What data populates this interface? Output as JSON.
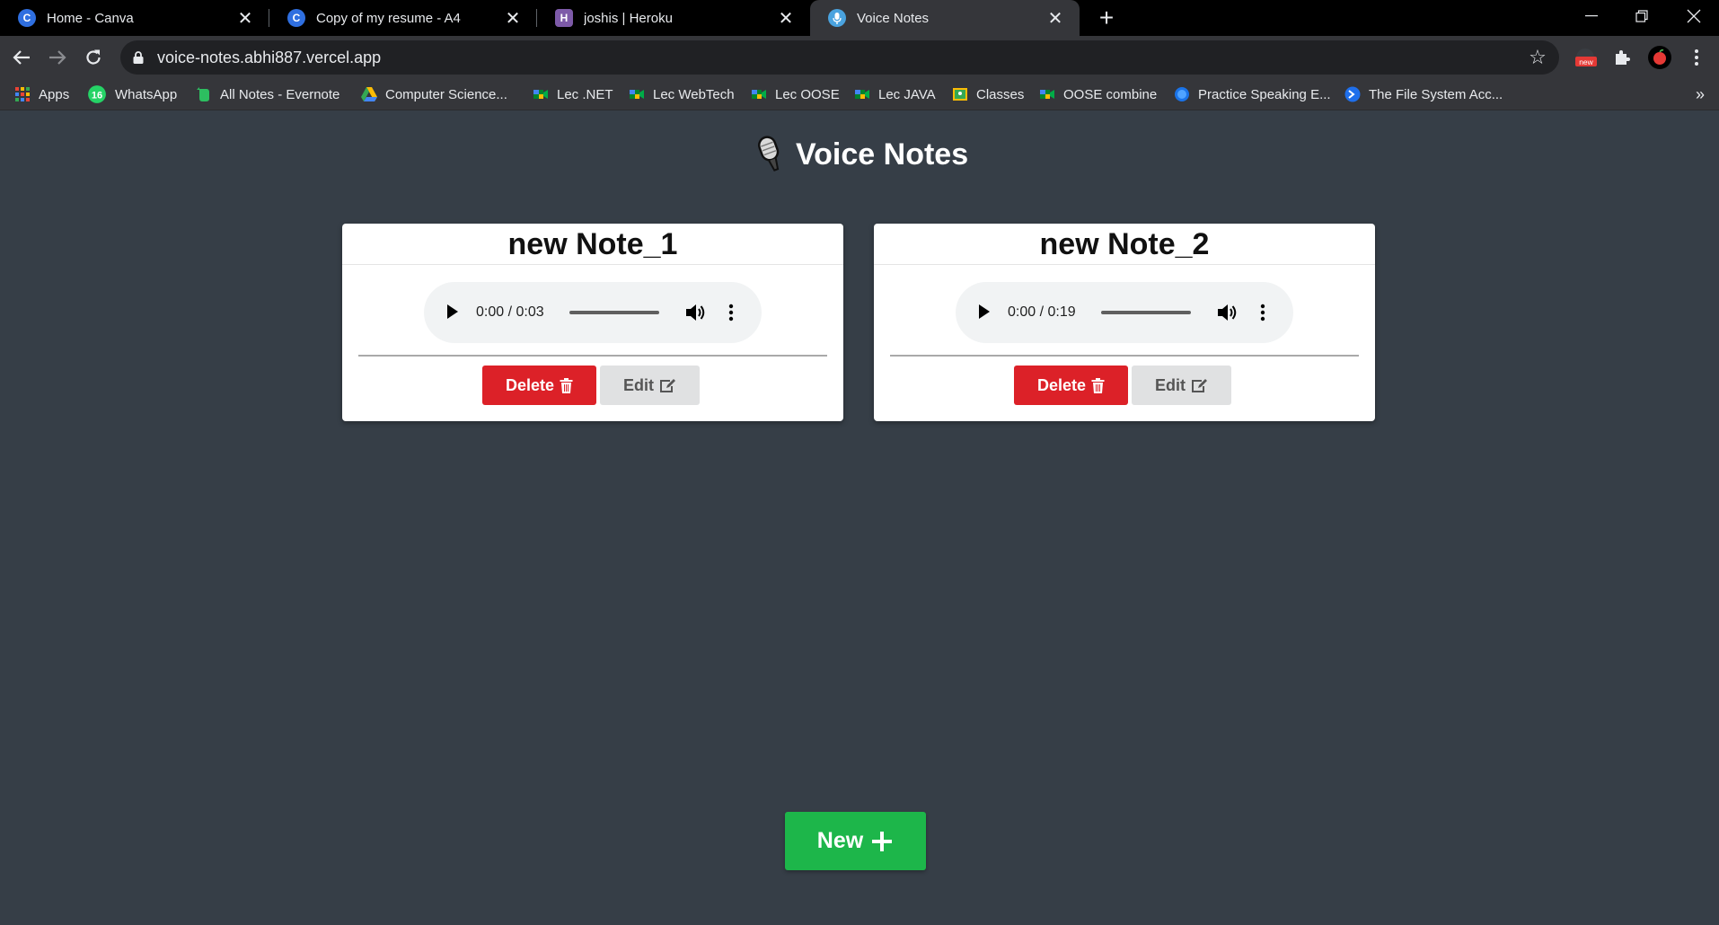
{
  "tabs": [
    {
      "title": "Home - Canva",
      "icon": "canva-icon",
      "color": "#3b82f6"
    },
    {
      "title": "Copy of my resume - A4",
      "icon": "canva-icon",
      "color": "#3b82f6"
    },
    {
      "title": "joshis | Heroku",
      "icon": "heroku-icon",
      "color": "#7d5aa8"
    },
    {
      "title": "Voice Notes",
      "icon": "microphone-icon",
      "color": "#4aa3df"
    }
  ],
  "url": "voice-notes.abhi887.vercel.app",
  "extension_badge": "new",
  "bookmarks": [
    {
      "label": "Apps",
      "icon": "apps-grid-icon"
    },
    {
      "label": "WhatsApp",
      "icon": "whatsapp-icon",
      "badge": "16"
    },
    {
      "label": "All Notes - Evernote",
      "icon": "evernote-icon"
    },
    {
      "label": "Computer Science...",
      "icon": "google-drive-icon"
    },
    {
      "label": "Lec .NET",
      "icon": "google-meet-icon"
    },
    {
      "label": "Lec WebTech",
      "icon": "google-meet-icon"
    },
    {
      "label": "Lec OOSE",
      "icon": "google-meet-icon"
    },
    {
      "label": "Lec JAVA",
      "icon": "google-meet-icon"
    },
    {
      "label": "Classes",
      "icon": "google-classroom-icon"
    },
    {
      "label": "OOSE combine",
      "icon": "google-meet-icon"
    },
    {
      "label": "Practice Speaking E...",
      "icon": "globe-icon"
    },
    {
      "label": "The File System Acc...",
      "icon": "terminal-icon"
    }
  ],
  "page": {
    "title": "Voice Notes"
  },
  "notes": [
    {
      "title": "new Note_1",
      "time": "0:00 / 0:03",
      "delete_label": "Delete",
      "edit_label": "Edit"
    },
    {
      "title": "new Note_2",
      "time": "0:00 / 0:19",
      "delete_label": "Delete",
      "edit_label": "Edit"
    }
  ],
  "new_button": {
    "label": "New"
  },
  "colors": {
    "background": "#363e47",
    "delete": "#dc2128",
    "new": "#1db64a"
  }
}
